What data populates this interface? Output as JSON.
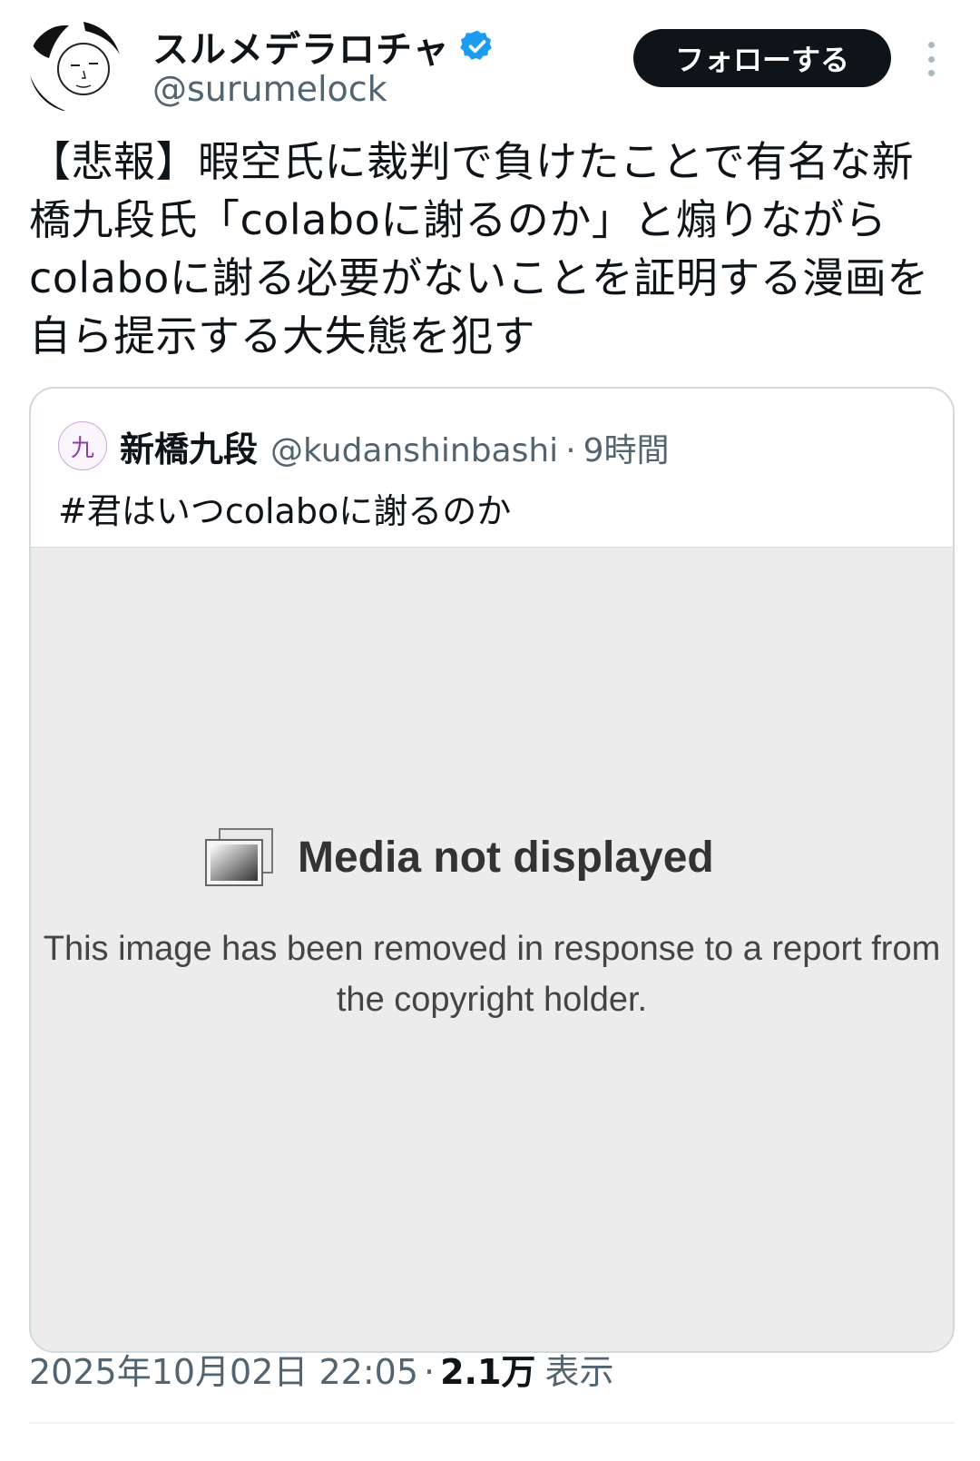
{
  "author": {
    "display_name": "スルメデラロチャ",
    "handle": "@surumelock",
    "verified": true,
    "verified_color": "#1d9bf0"
  },
  "follow_button": {
    "label": "フォローする"
  },
  "more_icon": "more-vertical-icon",
  "tweet": {
    "text": "【悲報】暇空氏に裁判で負けたことで有名な新橋九段氏「colaboに謝るのか」と煽りながらcolaboに謝る必要がないことを証明する漫画を自ら提示する大失態を犯す"
  },
  "quote": {
    "avatar_glyph": "九",
    "display_name": "新橋九段",
    "handle": "@kudanshinbashi",
    "separator": "·",
    "time": "9時間",
    "text": "#君はいつcolaboに謝るのか",
    "media": {
      "icon": "image-placeholder-icon",
      "title": "Media not displayed",
      "description": "This image has been removed in response to a report from the copyright holder."
    }
  },
  "footer": {
    "timestamp": "2025年10月02日 22:05",
    "separator": "·",
    "views_count": "2.1万",
    "views_label": "表示"
  }
}
